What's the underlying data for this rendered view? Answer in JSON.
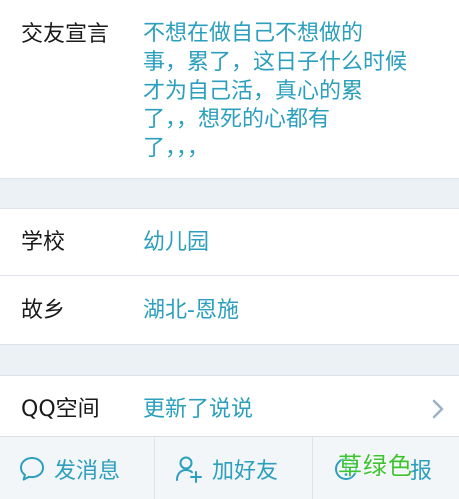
{
  "profile": {
    "bio": {
      "label": "交友宣言",
      "lines": [
        "不想在做自己不想做的",
        "事，累了，这日子什么时候",
        "才为自己活，真心的累",
        "了，，想死的心都有",
        "了，，，"
      ]
    },
    "school": {
      "label": "学校",
      "value": "幼儿园"
    },
    "hometown": {
      "label": "故乡",
      "value": "湖北-恩施"
    },
    "qzone": {
      "label": "QQ空间",
      "value": "更新了说说"
    }
  },
  "actions": {
    "message": {
      "label": "发消息",
      "icon": "chat-bubble-icon"
    },
    "add_friend": {
      "label": "加好友",
      "icon": "add-user-icon"
    },
    "report": {
      "label": "报",
      "icon": "report-icon"
    }
  },
  "watermark": {
    "text": "草绿色"
  },
  "colors": {
    "accent": "#2b9fbd",
    "label": "#1a1a1a",
    "section_gap": "#ecf1f6",
    "bottom_bar": "#f3f6f9",
    "watermark": "#3cc430"
  }
}
